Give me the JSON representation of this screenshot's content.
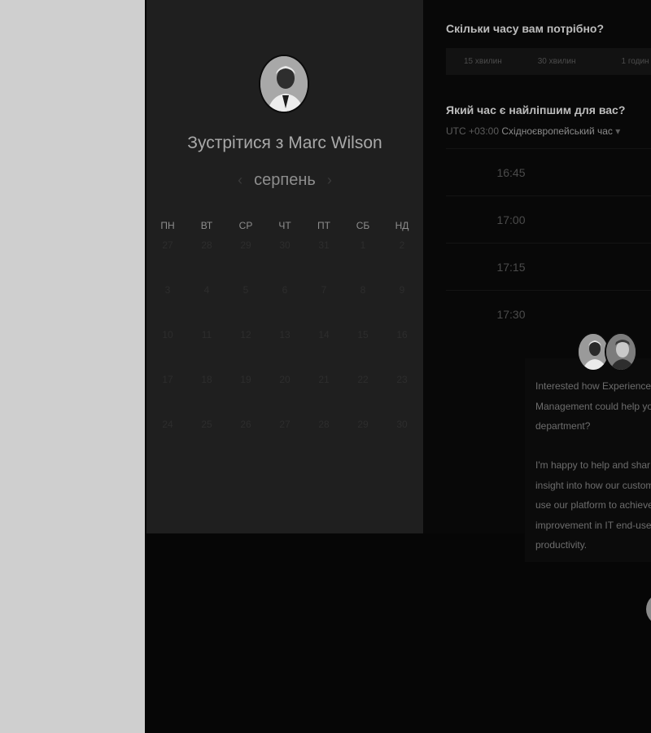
{
  "booking": {
    "host_title": "Зустрітися з Marc Wilson",
    "calendar": {
      "month": "серпень",
      "prev_icon": "chevron-left-icon",
      "next_icon": "chevron-right-icon",
      "weekdays": [
        "ПН",
        "ВТ",
        "СР",
        "ЧТ",
        "ПТ",
        "СБ",
        "НД"
      ],
      "weeks": [
        [
          "27",
          "28",
          "29",
          "30",
          "31",
          "1",
          "2"
        ],
        [
          "3",
          "4",
          "5",
          "6",
          "7",
          "8",
          "9"
        ],
        [
          "10",
          "11",
          "12",
          "13",
          "14",
          "15",
          "16"
        ],
        [
          "17",
          "18",
          "19",
          "20",
          "21",
          "22",
          "23"
        ],
        [
          "24",
          "25",
          "26",
          "27",
          "28",
          "29",
          "30"
        ]
      ]
    },
    "duration_question": "Скільки часу вам потрібно?",
    "durations": [
      "15 хвилин",
      "30 хвилин",
      "1 годин"
    ],
    "time_question": "Який час є найліпшим для вас?",
    "timezone_offset": "UTC +03:00",
    "timezone_name": "Східноєвропейський час",
    "times": [
      "16:45",
      "17:00",
      "17:15",
      "17:30"
    ]
  },
  "chat": {
    "message_1": "Interested how Experience\nManagement could help yo\ndepartment?",
    "message_2": "I'm happy to help and shar\ninsight into how our custom\nuse our platform to achieve\nimprovement in IT end-use\nproductivity."
  },
  "colors": {
    "backdrop": "#060606",
    "page_bg": "#cfcfcf",
    "card_bg": "#1f1f1f"
  }
}
